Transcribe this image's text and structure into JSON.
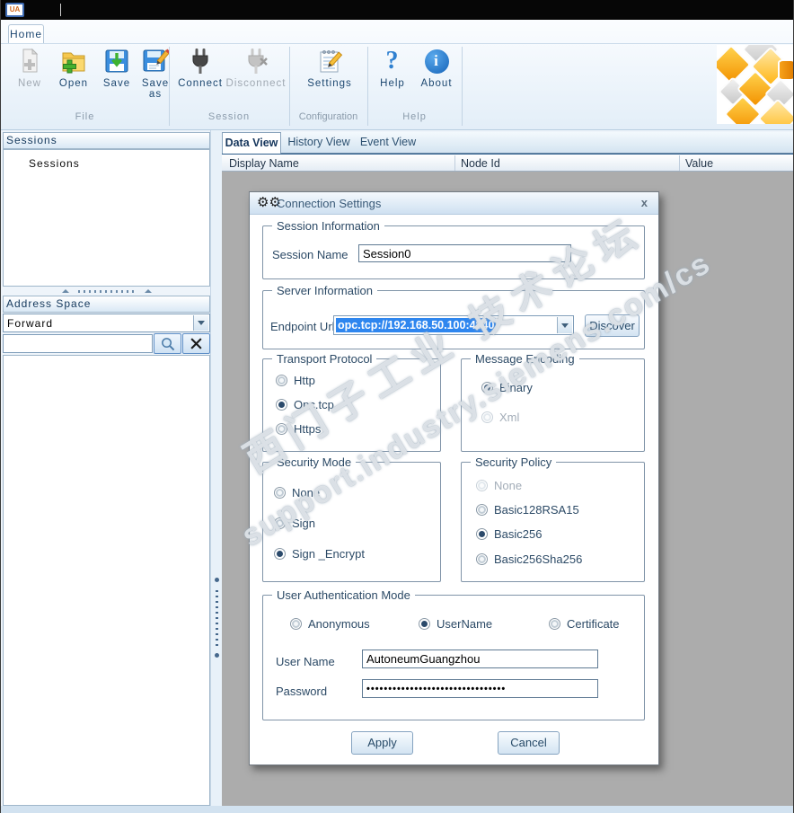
{
  "window": {
    "app_icon_text": "UA"
  },
  "ribbon": {
    "home_tab": "Home",
    "file_group": {
      "label": "File",
      "new": "New",
      "open": "Open",
      "save": "Save",
      "save_as": "Save as"
    },
    "session_group": {
      "label": "Session",
      "connect": "Connect",
      "disconnect": "Disconnect"
    },
    "configuration_group": {
      "label": "Configuration",
      "settings": "Settings"
    },
    "help_group": {
      "label": "Help",
      "help": "Help",
      "about": "About",
      "help_glyph": "?",
      "about_glyph": "i"
    }
  },
  "sidebar": {
    "sessions_header": "Sessions",
    "tree_root": "Sessions",
    "address_space_header": "Address Space",
    "direction_value": "Forward",
    "search_value": ""
  },
  "main": {
    "tabs": [
      "Data View",
      "History View",
      "Event View"
    ],
    "active_tab": "Data View",
    "columns": [
      "Display Name",
      "Node Id",
      "Value"
    ]
  },
  "dialog": {
    "title": "Connection Settings",
    "close_label": "x",
    "gears_glyph": "⚙⚙",
    "session_info": {
      "legend": "Session Information",
      "session_name_label": "Session Name",
      "session_name_value": "Session0"
    },
    "server_info": {
      "legend": "Server Information",
      "endpoint_label": "Endpoint Url",
      "endpoint_value": "opc.tcp://192.168.50.100:4840",
      "discover_label": "Discover"
    },
    "transport": {
      "legend": "Transport Protocol",
      "options": [
        {
          "label": "Http",
          "state": "enabled"
        },
        {
          "label": "Opc.tcp",
          "state": "selected"
        },
        {
          "label": "Https",
          "state": "enabled"
        }
      ]
    },
    "encoding": {
      "legend": "Message Encoding",
      "options": [
        {
          "label": "Binary",
          "state": "selected"
        },
        {
          "label": "Xml",
          "state": "disabled"
        }
      ]
    },
    "security_mode": {
      "legend": "Security Mode",
      "options": [
        {
          "label": "None",
          "state": "enabled"
        },
        {
          "label": "Sign",
          "state": "enabled"
        },
        {
          "label": "Sign _Encrypt",
          "state": "selected"
        }
      ]
    },
    "security_policy": {
      "legend": "Security Policy",
      "options": [
        {
          "label": "None",
          "state": "disabled"
        },
        {
          "label": "Basic128RSA15",
          "state": "enabled"
        },
        {
          "label": "Basic256",
          "state": "selected"
        },
        {
          "label": "Basic256Sha256",
          "state": "enabled"
        }
      ]
    },
    "auth": {
      "legend": "User Authentication Mode",
      "options": [
        {
          "label": "Anonymous",
          "state": "enabled"
        },
        {
          "label": "UserName",
          "state": "selected"
        },
        {
          "label": "Certificate",
          "state": "enabled"
        }
      ],
      "user_name_label": "User Name",
      "user_name_value": "AutoneumGuangzhou",
      "password_label": "Password",
      "password_value": "••••••••••••••••••••••••••••••••"
    },
    "apply_label": "Apply",
    "cancel_label": "Cancel"
  },
  "watermark": {
    "line1": "西门子工业 技术论坛",
    "line2": "support.industry.siemens.com/cs"
  },
  "colors": {
    "selection_blue": "#2e86ef",
    "accent_navy": "#2b4a6b",
    "content_gray": "#acacac"
  }
}
